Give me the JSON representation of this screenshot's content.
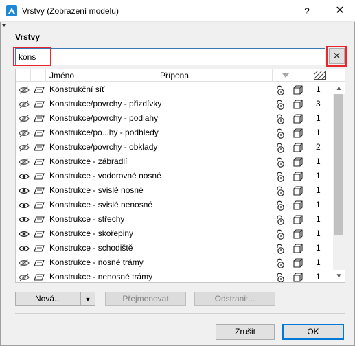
{
  "window": {
    "title": "Vrstvy (Zobrazení modelu)",
    "help_glyph": "?",
    "close_glyph": "✕"
  },
  "section_label": "Vrstvy",
  "search": {
    "value": "kons",
    "clear_glyph": "✕"
  },
  "columns": {
    "name": "Jméno",
    "suffix": "Přípona"
  },
  "rows": [
    {
      "name": "Konstrukční síť",
      "visible": false,
      "number": "1"
    },
    {
      "name": "Konstrukce/povrchy - přizdívky",
      "visible": false,
      "number": "3"
    },
    {
      "name": "Konstrukce/povrchy - podlahy",
      "visible": false,
      "number": "1"
    },
    {
      "name": "Konstrukce/po...hy - podhledy",
      "visible": false,
      "number": "1"
    },
    {
      "name": "Konstrukce/povrchy - obklady",
      "visible": false,
      "number": "2"
    },
    {
      "name": "Konstrukce - zábradlí",
      "visible": false,
      "number": "1"
    },
    {
      "name": "Konstrukce - vodorovné nosné",
      "visible": true,
      "number": "1"
    },
    {
      "name": "Konstrukce - svislé nosné",
      "visible": true,
      "number": "1"
    },
    {
      "name": "Konstrukce - svislé nenosné",
      "visible": true,
      "number": "1"
    },
    {
      "name": "Konstrukce - střechy",
      "visible": true,
      "number": "1"
    },
    {
      "name": "Konstrukce - skořepiny",
      "visible": true,
      "number": "1"
    },
    {
      "name": "Konstrukce - schodiště",
      "visible": true,
      "number": "1"
    },
    {
      "name": "Konstrukce - nosné trámy",
      "visible": false,
      "number": "1"
    },
    {
      "name": "Konstrukce - nenosné trámy",
      "visible": false,
      "number": "1"
    }
  ],
  "buttons": {
    "new": "Nová...",
    "rename": "Přejmenovat",
    "delete": "Odstranit...",
    "cancel": "Zrušit",
    "ok": "OK"
  },
  "colors": {
    "highlight": "#e8262d",
    "focus_border": "#0078d7",
    "app_icon": "#1e88d8"
  },
  "icons": {
    "visible": "eye-icon",
    "hidden": "eye-crossed-icon",
    "layer": "layer-plane-icon",
    "lock": "lock-icon",
    "wireframe": "box-wireframe-icon",
    "hatch": "hatch-icon"
  }
}
